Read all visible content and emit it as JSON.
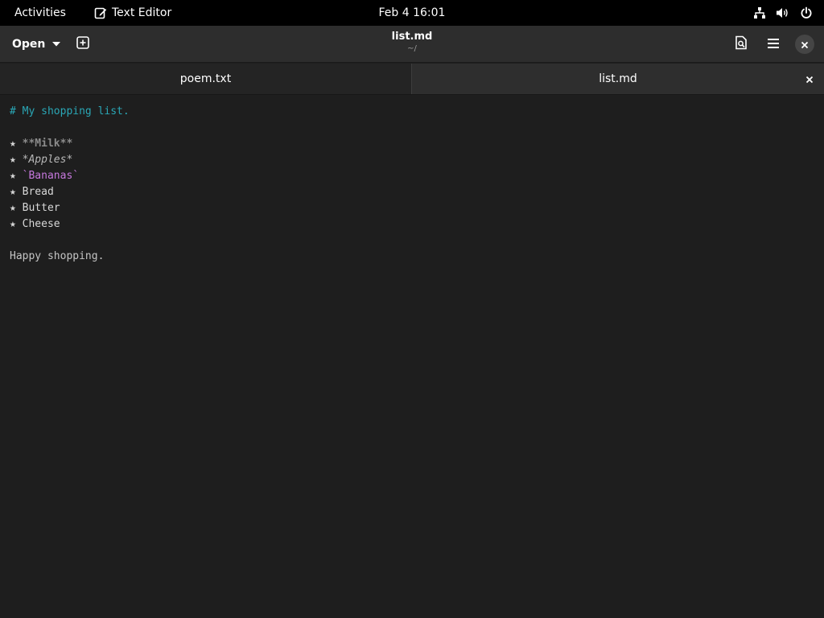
{
  "topbar": {
    "activities": "Activities",
    "app_name": "Text Editor",
    "clock": "Feb 4  16:01",
    "icons": [
      "network-icon",
      "volume-icon",
      "power-icon"
    ]
  },
  "headerbar": {
    "open_label": "Open",
    "title": "list.md",
    "subtitle": "~/",
    "icons": [
      "chevron-down-icon",
      "new-tab-icon",
      "search-document-icon",
      "hamburger-menu-icon",
      "close-icon"
    ]
  },
  "tabs": [
    {
      "label": "poem.txt",
      "active": false
    },
    {
      "label": "list.md",
      "active": true
    }
  ],
  "document": {
    "heading": "# My shopping list.",
    "bullet": "★",
    "items": [
      {
        "text": "**Milk**",
        "style": "bold"
      },
      {
        "text": "*Apples*",
        "style": "italic"
      },
      {
        "text": "`Bananas`",
        "style": "code"
      },
      {
        "text": "Bread",
        "style": "plain"
      },
      {
        "text": "Butter",
        "style": "plain"
      },
      {
        "text": "Cheese",
        "style": "plain"
      }
    ],
    "footer": "Happy shopping."
  },
  "colors": {
    "heading": "#2aa7b6",
    "code": "#c678dd",
    "background": "#1e1e1e"
  }
}
